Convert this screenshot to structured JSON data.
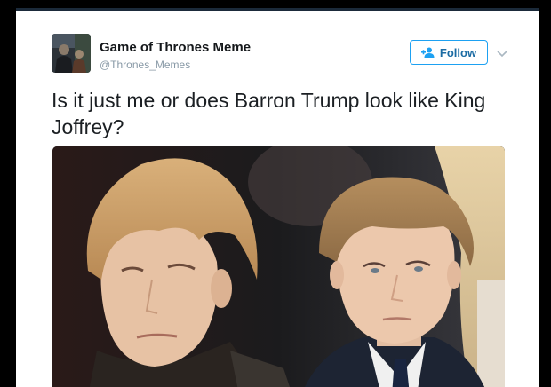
{
  "tweet": {
    "display_name": "Game of Thrones Meme",
    "handle": "@Thrones_Memes",
    "follow_label": "Follow",
    "text": "Is it just me or does Barron Trump look like King Joffrey?",
    "avatar_icon": "profile-photo",
    "follow_icon": "add-person-icon",
    "more_icon": "chevron-down-icon"
  },
  "colors": {
    "accent": "#1da1f2",
    "text": "#14171a",
    "muted": "#8899a6",
    "frame": "#000000"
  }
}
